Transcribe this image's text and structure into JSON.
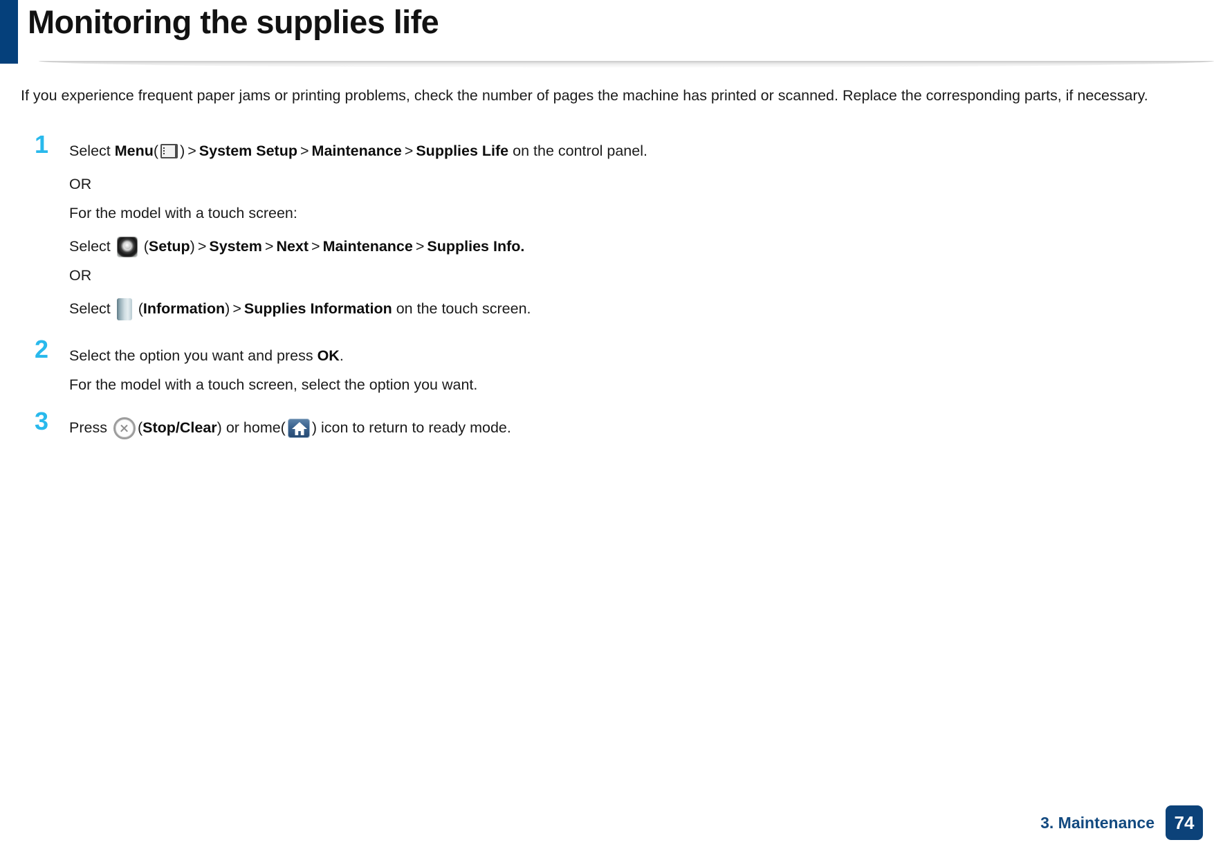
{
  "header": {
    "title": "Monitoring the supplies life",
    "accent_color": "#05407b"
  },
  "intro": {
    "paragraph": "If you experience frequent paper jams or printing problems, check the number of pages the machine has printed or scanned. Replace the corresponding parts, if necessary."
  },
  "steps": [
    {
      "number": "1",
      "lines": {
        "line1_select": "Select",
        "line1_menu": "Menu",
        "line1_open_paren": "(",
        "line1_close_paren": ")",
        "line1_sep1": ">",
        "line1_system_setup": "System Setup",
        "line1_sep2": ">",
        "line1_maintenance": "Maintenance",
        "line1_sep3": ">",
        "line1_supplies_life": "Supplies Life",
        "line1_tail": "on the control panel.",
        "or_1": "OR",
        "touch_intro": "For the model with a touch screen:",
        "line2_select": "Select",
        "line2_setup": "Setup",
        "line2_sep1": ">",
        "line2_system": "System",
        "line2_sep2": ">",
        "line2_next": "Next",
        "line2_sep3": ">",
        "line2_maintenance": "Maintenance",
        "line2_sep4": ">",
        "line2_supplies_info": "Supplies Info.",
        "or_2": "OR",
        "line3_select": "Select",
        "line3_information": "Information",
        "line3_sep1": ">",
        "line3_supplies_information": "Supplies Information",
        "line3_tail": "on the touch screen."
      }
    },
    {
      "number": "2",
      "lines": {
        "line1_pre": "Select the option you want and press",
        "line1_ok": "OK",
        "line1_post": ".",
        "line2": "For the model with a touch screen, select the option you want."
      }
    },
    {
      "number": "3",
      "lines": {
        "pre": "Press",
        "stop_clear_open": "(",
        "stop_clear": "Stop/Clear",
        "stop_clear_close": ")",
        "mid": "or home(",
        "post": ") icon to return to ready mode."
      }
    }
  ],
  "icons": {
    "menu": "menu-icon",
    "setup": "gear-setup-icon",
    "information": "information-icon",
    "stop_clear": "stop-clear-icon",
    "home": "home-icon"
  },
  "footer": {
    "chapter": "3. Maintenance",
    "page_number": "74",
    "accent_color": "#0c4279"
  },
  "step_number_color": "#29b9ec"
}
